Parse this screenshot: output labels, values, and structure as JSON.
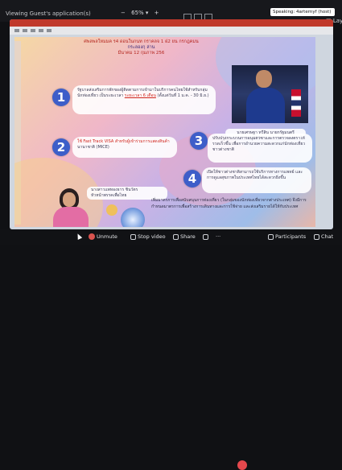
{
  "topbar": {
    "sharing_label": "Viewing Guest's application(s)",
    "zoom_value": "65%",
    "speaking_label": "Speaking: 4arternyf (host)",
    "layout_label": "Layout"
  },
  "slide": {
    "header_line1": "ศพลพลใหมมค ร4 ดอนในกนท กราคลจ 1 ฝ2 ยน กรกฎคมน",
    "header_line2": "กระลองกุ ล่าน",
    "header_line3": "มีนาคม 12 กุมภาพ 256",
    "items": [
      {
        "number": "1",
        "text": "รัฐบาลส่งเสริมการพักของผู้ติดตามการเข้ามาในบริการคนไทยใช้สำหรับกลุ่มนักท่องเที่ยว เป็นระยะเวลา",
        "highlight": "ระยะเวลา 6 เดือน",
        "text2": "(ตั้งแต่วันที่ 1 ม.ค. - 30 มิ.ย.)"
      },
      {
        "number": "2",
        "fast": "ใช้ Fast Track VISA สำหรับผู้เข้าร่วมการแสดงสินค้า",
        "text": "นานาชาติ (MICE)"
      },
      {
        "number": "3",
        "text": "ปรับปรุงกระบวนการอนุมัติวีซ่าและการตรวจลงตราให้รวดเร็วขึ้น เพื่อการอำนวยความสะดวกแก่นักท่องเที่ยวชาวต่างชาติ"
      },
      {
        "number": "4",
        "text": "เปิดให้ชาวต่างชาติสามารถใช้บริการทางการแพทย์ และการดูแลสุขภาพในประเทศไทยได้สะดวกยิ่งขึ้น"
      }
    ],
    "caption1": "นายเศรษฐา ทวีสิน นายกรัฐมนตรี",
    "caption2_line1": "นางสาวแพทองธาร ชินวัตร",
    "caption2_line2": "หัวหน้าพรรคเพื่อไทย",
    "bottom_text": "เพิ่มมาตรการเพื่อสนับสนุนการท่องเที่ยว (ในกลุ่มของนักท่องเที่ยวจากต่างประเทศ) จึงมีการกำหนดมาตรการเพื่อสร้างการเดินทางและการใช้จ่าย และส่งเสริมรายได้ให้กับประเทศ"
  },
  "toolbar": {
    "unmute_label": "Unmute",
    "stop_video_label": "Stop video",
    "share_label": "Share",
    "participants_label": "Participants",
    "chat_label": "Chat"
  }
}
